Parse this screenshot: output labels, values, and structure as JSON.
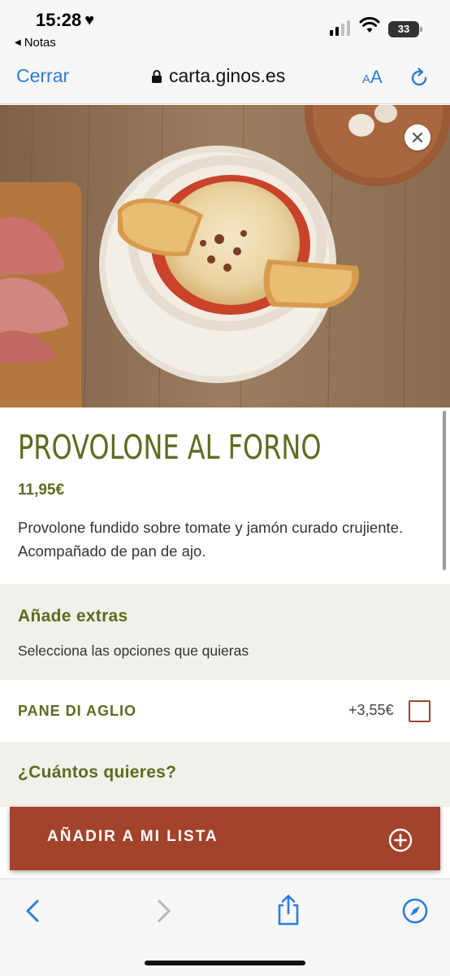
{
  "status_bar": {
    "time": "15:28",
    "back_app": "Notas",
    "battery": "33"
  },
  "browser": {
    "close_label": "Cerrar",
    "url": "carta.ginos.es",
    "text_size_small": "A",
    "text_size_large": "A"
  },
  "product": {
    "title": "PROVOLONE AL FORNO",
    "price": "11,95€",
    "description": "Provolone fundido sobre tomate y jamón curado crujiente. Acompañado de pan de ajo."
  },
  "extras": {
    "title": "Añade extras",
    "subtitle": "Selecciona las opciones que quieras",
    "options": [
      {
        "name": "PANE DI AGLIO",
        "price": "+3,55€",
        "checked": false
      }
    ]
  },
  "quantity": {
    "title": "¿Cuántos quieres?"
  },
  "add_button": {
    "label": "AÑADIR A MI LISTA"
  },
  "colors": {
    "accent_green": "#5a6d1f",
    "button_red": "#a3432b",
    "link_blue": "#2a7ee0",
    "section_bg": "#f2f0ea"
  }
}
